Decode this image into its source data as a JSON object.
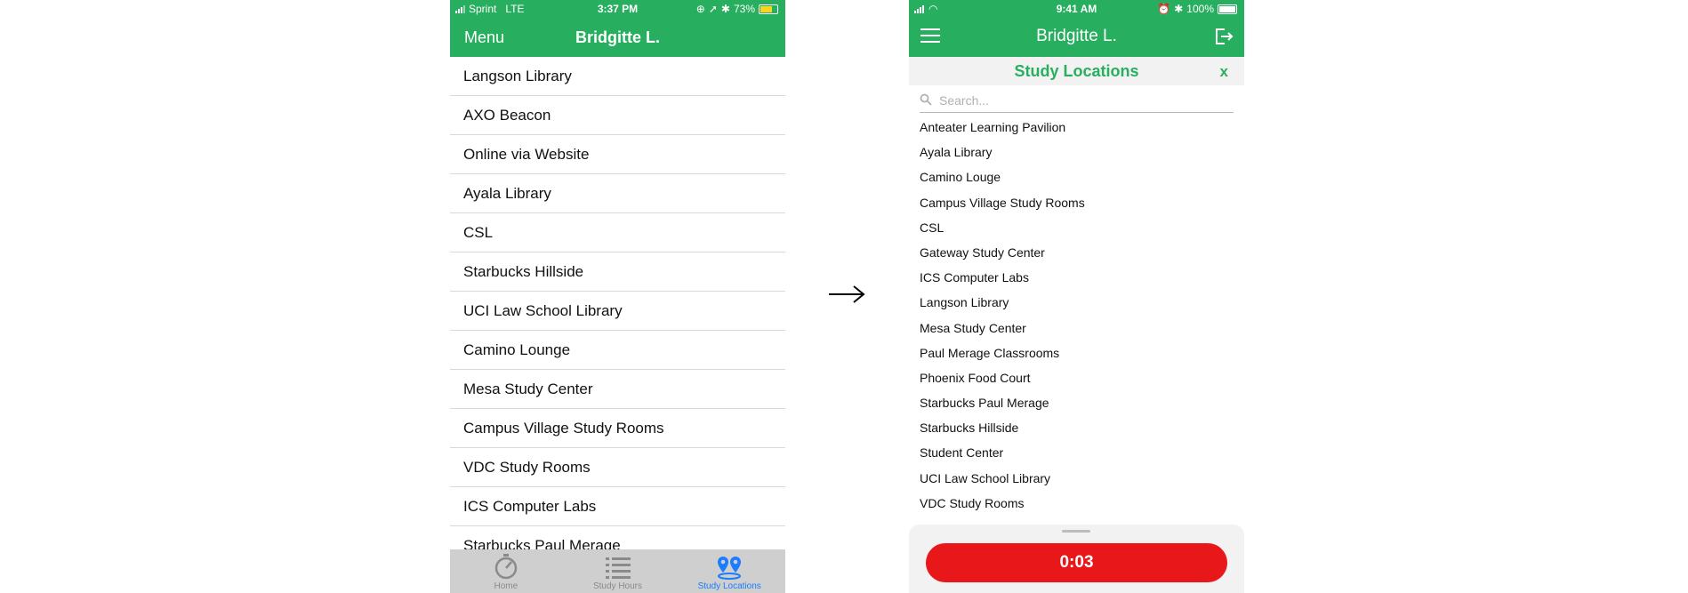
{
  "left_phone": {
    "status": {
      "carrier": "Sprint",
      "network": "LTE",
      "time": "3:37 PM",
      "battery": "73%"
    },
    "nav": {
      "menu_label": "Menu",
      "title": "Bridgitte L."
    },
    "list": [
      "Langson Library",
      "AXO Beacon",
      "Online via Website",
      "Ayala Library",
      "CSL",
      "Starbucks Hillside",
      "UCI Law School Library",
      "Camino Lounge",
      "Mesa Study Center",
      "Campus Village Study Rooms",
      "VDC Study Rooms",
      "ICS Computer Labs",
      "Starbucks Paul Merage"
    ],
    "tabs": [
      {
        "label": "Home",
        "icon": "stopwatch-icon",
        "active": false
      },
      {
        "label": "Study Hours",
        "icon": "list-icon",
        "active": false
      },
      {
        "label": "Study Locations",
        "icon": "map-pins-icon",
        "active": true
      }
    ],
    "colors": {
      "header": "#27ae5f",
      "tab_active": "#1a7cff",
      "battery": "#ffd21f"
    }
  },
  "arrow": {
    "symbol": "→"
  },
  "right_phone": {
    "status": {
      "time": "9:41 AM",
      "battery": "100%"
    },
    "nav": {
      "title": "Bridgitte L."
    },
    "section": {
      "title": "Study Locations",
      "close_label": "x"
    },
    "search": {
      "placeholder": "Search..."
    },
    "list": [
      "Anteater Learning Pavilion",
      "Ayala Library",
      "Camino Louge",
      "Campus Village Study Rooms",
      "CSL",
      "Gateway Study Center",
      "ICS Computer Labs",
      "Langson Library",
      "Mesa Study Center",
      "Paul Merage Classrooms",
      "Phoenix Food Court",
      "Starbucks Paul Merage",
      "Starbucks Hillside",
      "Student Center",
      "UCI Law School Library",
      "VDC Study Rooms"
    ],
    "timer": {
      "label": "0:03"
    },
    "colors": {
      "header": "#27ae5f",
      "timer": "#e8171a"
    }
  }
}
